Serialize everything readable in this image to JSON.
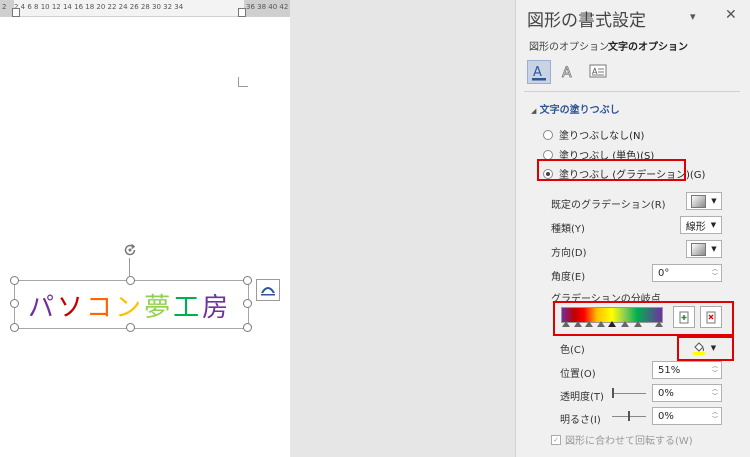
{
  "ruler": {
    "numbers": "2  4  6  8  10 12 14 16 18 20 22 24 26 28 30 32 34",
    "numbers_right": "36 38 40 42",
    "left_mark": "2"
  },
  "document": {
    "wordart_chars": [
      {
        "ch": "パ",
        "color": "#7030a0"
      },
      {
        "ch": "ソ",
        "color": "#c00000"
      },
      {
        "ch": "コ",
        "color": "#ff6600"
      },
      {
        "ch": "ン",
        "color": "#ffc000"
      },
      {
        "ch": "夢",
        "color": "#92d050"
      },
      {
        "ch": "工",
        "color": "#00b050"
      },
      {
        "ch": "房",
        "color": "#7030a0"
      }
    ]
  },
  "pane": {
    "title": "図形の書式設定",
    "dropdown_glyph": "▾",
    "close_glyph": "✕",
    "tabs": {
      "shape": "図形のオプション",
      "text": "文字のオプション"
    },
    "section_title": "文字の塗りつぶし",
    "radios": [
      {
        "label": "塗りつぶしなし(N)",
        "checked": false
      },
      {
        "label": "塗りつぶし (単色)(S)",
        "checked": false
      },
      {
        "label": "塗りつぶし (グラデーション)(G)",
        "checked": true
      }
    ],
    "preset_label": "既定のグラデーション(R)",
    "type_label": "種類(Y)",
    "type_value": "線形",
    "direction_label": "方向(D)",
    "angle_label": "角度(E)",
    "angle_value": "0°",
    "stops_label": "グラデーションの分岐点",
    "color_label": "色(C)",
    "position_label": "位置(O)",
    "position_value": "51%",
    "transparency_label": "透明度(T)",
    "transparency_value": "0%",
    "brightness_label": "明るさ(I)",
    "brightness_value": "0%",
    "rotate_label": "図形に合わせて回転する(W)",
    "highlight_color": "#e00000",
    "accent_color": "#2f5597"
  }
}
